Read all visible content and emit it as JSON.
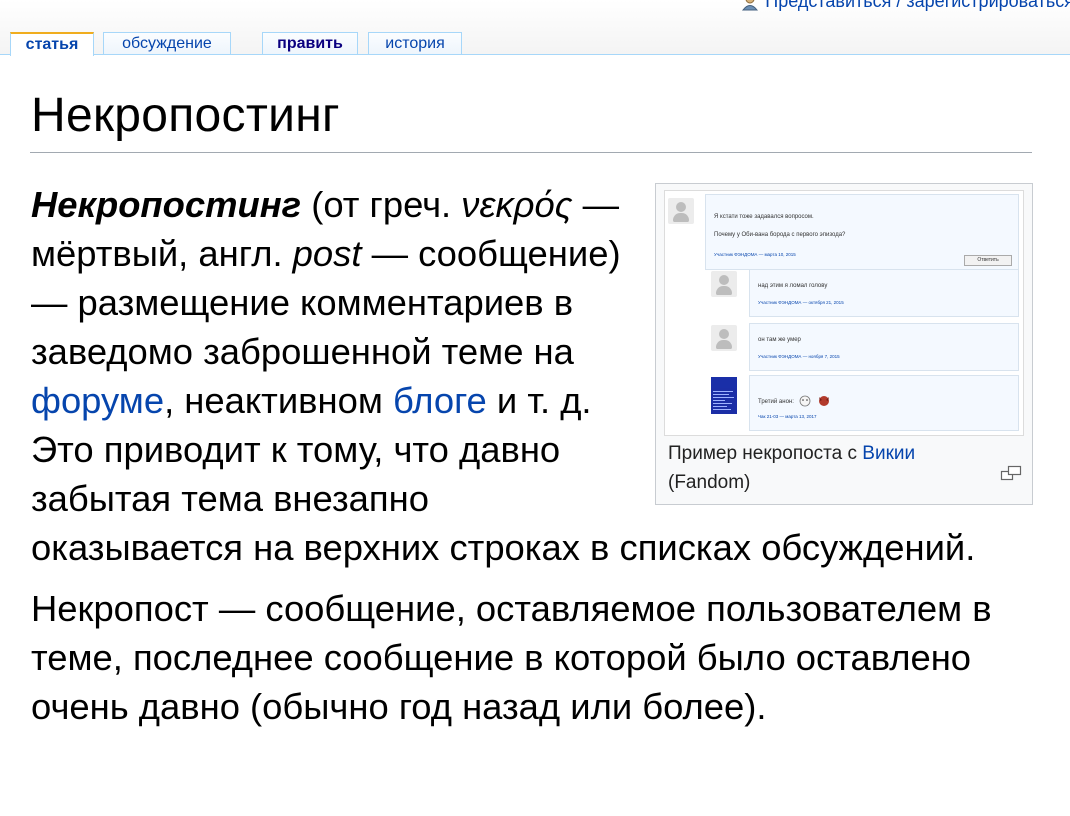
{
  "personal": {
    "links_text": "Представиться / зарегистрироваться"
  },
  "tabs": [
    {
      "label": "статья"
    },
    {
      "label": "обсуждение"
    },
    {
      "label": "править"
    },
    {
      "label": "история"
    }
  ],
  "article": {
    "title": "Некропостинг",
    "paragraph1": {
      "term": "Некропостинг",
      "t1": " (от греч. ",
      "greek": "νεκρός",
      "t2": " — мёртвый, англ. ",
      "post": "post",
      "t3": " — сообщение) — размещение комментариев в заведомо заброшенной теме на ",
      "link_forum": "форуме",
      "t4": ", неактивном ",
      "link_blog": "блоге",
      "t5": " и т. д. Это приводит к тому, что давно забытая тема внезапно оказывается на верхних строках в списках обсуждений."
    },
    "paragraph2": "Некропост — сообщение, оставляемое пользователем в теме, последнее сообщение в которой было оставлено очень давно (обычно год назад или более)."
  },
  "thumb": {
    "caption_prefix": "Пример некропоста с ",
    "caption_link": "Викии",
    "caption_suffix": " (Fandom)",
    "posts": [
      {
        "line1": "Я кстати тоже задавался вопросом.",
        "line2": "Почему у Оби-вана борода с первого эпизода?",
        "meta": "Участник ФЭНДОМА — марта 10, 2015",
        "button": "Ответить"
      },
      {
        "line1": "над этим я ломал голову",
        "meta": "Участник ФЭНДОМА — октября 21, 2015"
      },
      {
        "line1": "он там же умер",
        "meta": "Участник ФЭНДОМА — ноября 7, 2015"
      },
      {
        "line1": "Третий анон:",
        "meta": "Чак 21-03 — марта 13, 2017"
      }
    ]
  },
  "icons": {
    "user": "user-icon",
    "magnify": "magnify-icon"
  },
  "colors": {
    "link": "#0645ad",
    "tab_border": "#a7d7f9",
    "rule": "#a2a9b1"
  }
}
